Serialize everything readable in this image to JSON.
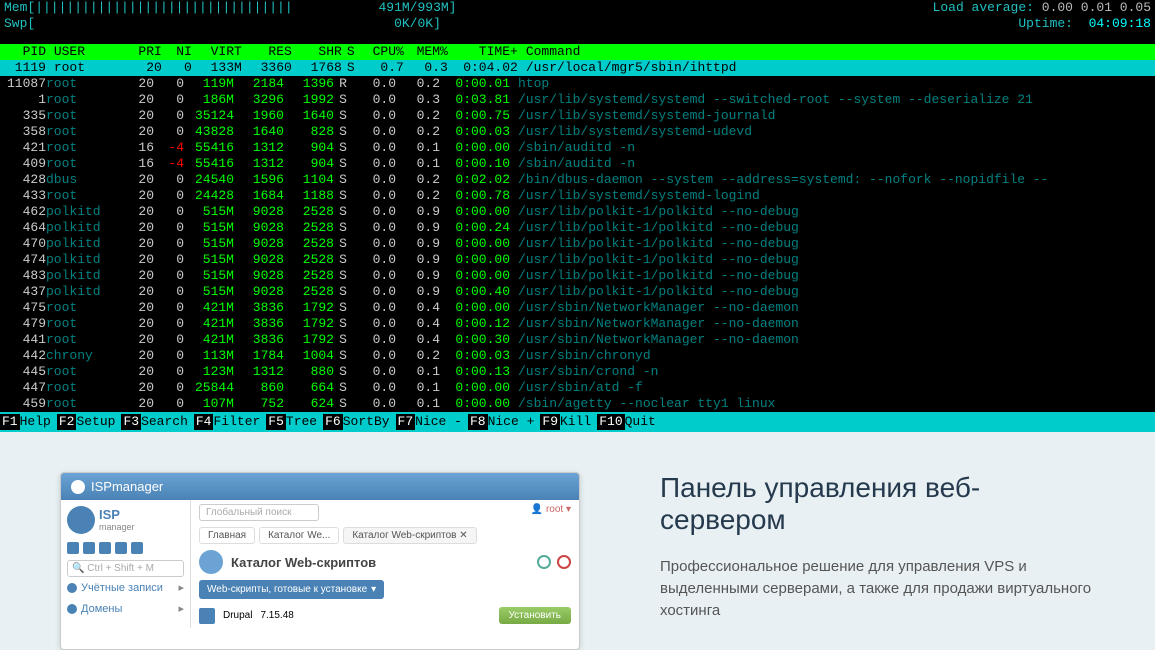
{
  "header": {
    "mem_label": "Mem",
    "mem_bar": "[|||||||||||||||||||||||||||||||||           491M/993M]",
    "swp_label": "Swp",
    "swp_bar": "[                                              0K/0K]",
    "load_label": "Load average:",
    "load_values": "0.00 0.01 0.05",
    "uptime_label": "Uptime:",
    "uptime_value": "04:09:18"
  },
  "columns": {
    "pid": "PID",
    "user": "USER",
    "pri": "PRI",
    "ni": "NI",
    "virt": "VIRT",
    "res": "RES",
    "shr": "SHR",
    "s": "S",
    "cpu": "CPU%",
    "mem": "MEM%",
    "time": "TIME+",
    "cmd": "Command"
  },
  "selected": {
    "pid": "1119",
    "user": "root",
    "pri": "20",
    "ni": "0",
    "virt": "133M",
    "res": "3360",
    "shr": "1768",
    "s": "S",
    "cpu": "0.7",
    "mem": "0.3",
    "time": "0:04.02",
    "cmd": "/usr/local/mgr5/sbin/ihttpd"
  },
  "processes": [
    {
      "pid": "11087",
      "user": "root",
      "pri": "20",
      "ni": "0",
      "virt": "119M",
      "res": "2184",
      "shr": "1396",
      "s": "R",
      "cpu": "0.0",
      "mem": "0.2",
      "time": "0:00.01",
      "cmd": "htop"
    },
    {
      "pid": "1",
      "user": "root",
      "pri": "20",
      "ni": "0",
      "virt": "186M",
      "res": "3296",
      "shr": "1992",
      "s": "S",
      "cpu": "0.0",
      "mem": "0.3",
      "time": "0:03.81",
      "cmd": "/usr/lib/systemd/systemd --switched-root --system --deserialize 21"
    },
    {
      "pid": "335",
      "user": "root",
      "pri": "20",
      "ni": "0",
      "virt": "35124",
      "res": "1960",
      "shr": "1640",
      "s": "S",
      "cpu": "0.0",
      "mem": "0.2",
      "time": "0:00.75",
      "cmd": "/usr/lib/systemd/systemd-journald"
    },
    {
      "pid": "358",
      "user": "root",
      "pri": "20",
      "ni": "0",
      "virt": "43828",
      "res": "1640",
      "shr": "828",
      "s": "S",
      "cpu": "0.0",
      "mem": "0.2",
      "time": "0:00.03",
      "cmd": "/usr/lib/systemd/systemd-udevd"
    },
    {
      "pid": "421",
      "user": "root",
      "pri": "16",
      "ni": "-4",
      "virt": "55416",
      "res": "1312",
      "shr": "904",
      "s": "S",
      "cpu": "0.0",
      "mem": "0.1",
      "time": "0:00.00",
      "cmd": "/sbin/auditd -n"
    },
    {
      "pid": "409",
      "user": "root",
      "pri": "16",
      "ni": "-4",
      "virt": "55416",
      "res": "1312",
      "shr": "904",
      "s": "S",
      "cpu": "0.0",
      "mem": "0.1",
      "time": "0:00.10",
      "cmd": "/sbin/auditd -n"
    },
    {
      "pid": "428",
      "user": "dbus",
      "pri": "20",
      "ni": "0",
      "virt": "24540",
      "res": "1596",
      "shr": "1104",
      "s": "S",
      "cpu": "0.0",
      "mem": "0.2",
      "time": "0:02.02",
      "cmd": "/bin/dbus-daemon --system --address=systemd: --nofork --nopidfile --"
    },
    {
      "pid": "433",
      "user": "root",
      "pri": "20",
      "ni": "0",
      "virt": "24428",
      "res": "1684",
      "shr": "1188",
      "s": "S",
      "cpu": "0.0",
      "mem": "0.2",
      "time": "0:00.78",
      "cmd": "/usr/lib/systemd/systemd-logind"
    },
    {
      "pid": "462",
      "user": "polkitd",
      "pri": "20",
      "ni": "0",
      "virt": "515M",
      "res": "9028",
      "shr": "2528",
      "s": "S",
      "cpu": "0.0",
      "mem": "0.9",
      "time": "0:00.00",
      "cmd": "/usr/lib/polkit-1/polkitd --no-debug"
    },
    {
      "pid": "464",
      "user": "polkitd",
      "pri": "20",
      "ni": "0",
      "virt": "515M",
      "res": "9028",
      "shr": "2528",
      "s": "S",
      "cpu": "0.0",
      "mem": "0.9",
      "time": "0:00.24",
      "cmd": "/usr/lib/polkit-1/polkitd --no-debug"
    },
    {
      "pid": "470",
      "user": "polkitd",
      "pri": "20",
      "ni": "0",
      "virt": "515M",
      "res": "9028",
      "shr": "2528",
      "s": "S",
      "cpu": "0.0",
      "mem": "0.9",
      "time": "0:00.00",
      "cmd": "/usr/lib/polkit-1/polkitd --no-debug"
    },
    {
      "pid": "474",
      "user": "polkitd",
      "pri": "20",
      "ni": "0",
      "virt": "515M",
      "res": "9028",
      "shr": "2528",
      "s": "S",
      "cpu": "0.0",
      "mem": "0.9",
      "time": "0:00.00",
      "cmd": "/usr/lib/polkit-1/polkitd --no-debug"
    },
    {
      "pid": "483",
      "user": "polkitd",
      "pri": "20",
      "ni": "0",
      "virt": "515M",
      "res": "9028",
      "shr": "2528",
      "s": "S",
      "cpu": "0.0",
      "mem": "0.9",
      "time": "0:00.00",
      "cmd": "/usr/lib/polkit-1/polkitd --no-debug"
    },
    {
      "pid": "437",
      "user": "polkitd",
      "pri": "20",
      "ni": "0",
      "virt": "515M",
      "res": "9028",
      "shr": "2528",
      "s": "S",
      "cpu": "0.0",
      "mem": "0.9",
      "time": "0:00.40",
      "cmd": "/usr/lib/polkit-1/polkitd --no-debug"
    },
    {
      "pid": "475",
      "user": "root",
      "pri": "20",
      "ni": "0",
      "virt": "421M",
      "res": "3836",
      "shr": "1792",
      "s": "S",
      "cpu": "0.0",
      "mem": "0.4",
      "time": "0:00.00",
      "cmd": "/usr/sbin/NetworkManager --no-daemon"
    },
    {
      "pid": "479",
      "user": "root",
      "pri": "20",
      "ni": "0",
      "virt": "421M",
      "res": "3836",
      "shr": "1792",
      "s": "S",
      "cpu": "0.0",
      "mem": "0.4",
      "time": "0:00.12",
      "cmd": "/usr/sbin/NetworkManager --no-daemon"
    },
    {
      "pid": "441",
      "user": "root",
      "pri": "20",
      "ni": "0",
      "virt": "421M",
      "res": "3836",
      "shr": "1792",
      "s": "S",
      "cpu": "0.0",
      "mem": "0.4",
      "time": "0:00.30",
      "cmd": "/usr/sbin/NetworkManager --no-daemon"
    },
    {
      "pid": "442",
      "user": "chrony",
      "pri": "20",
      "ni": "0",
      "virt": "113M",
      "res": "1784",
      "shr": "1004",
      "s": "S",
      "cpu": "0.0",
      "mem": "0.2",
      "time": "0:00.03",
      "cmd": "/usr/sbin/chronyd"
    },
    {
      "pid": "445",
      "user": "root",
      "pri": "20",
      "ni": "0",
      "virt": "123M",
      "res": "1312",
      "shr": "880",
      "s": "S",
      "cpu": "0.0",
      "mem": "0.1",
      "time": "0:00.13",
      "cmd": "/usr/sbin/crond -n"
    },
    {
      "pid": "447",
      "user": "root",
      "pri": "20",
      "ni": "0",
      "virt": "25844",
      "res": "860",
      "shr": "664",
      "s": "S",
      "cpu": "0.0",
      "mem": "0.1",
      "time": "0:00.00",
      "cmd": "/usr/sbin/atd -f"
    },
    {
      "pid": "459",
      "user": "root",
      "pri": "20",
      "ni": "0",
      "virt": "107M",
      "res": "752",
      "shr": "624",
      "s": "S",
      "cpu": "0.0",
      "mem": "0.1",
      "time": "0:00.00",
      "cmd": "/sbin/agetty --noclear tty1 linux"
    }
  ],
  "fkeys": [
    {
      "fn": "F1",
      "lbl": "Help"
    },
    {
      "fn": "F2",
      "lbl": "Setup"
    },
    {
      "fn": "F3",
      "lbl": "Search"
    },
    {
      "fn": "F4",
      "lbl": "Filter"
    },
    {
      "fn": "F5",
      "lbl": "Tree"
    },
    {
      "fn": "F6",
      "lbl": "SortBy"
    },
    {
      "fn": "F7",
      "lbl": "Nice -"
    },
    {
      "fn": "F8",
      "lbl": "Nice +"
    },
    {
      "fn": "F9",
      "lbl": "Kill"
    },
    {
      "fn": "F10",
      "lbl": "Quit"
    }
  ],
  "panel": {
    "window_title": "ISPmanager",
    "logo_text": "ISP",
    "logo_sub": "manager",
    "search_placeholder": "Ctrl + Shift + M",
    "global_search": "Глобальный поиск",
    "user_label": "root",
    "menu": [
      {
        "label": "Учётные записи"
      },
      {
        "label": "Домены"
      }
    ],
    "breadcrumbs": [
      "Главная",
      "Каталог We...",
      "Каталог Web-скриптов"
    ],
    "catalog_title": "Каталог Web-скриптов",
    "dropdown": "Web-скрипты, готовые к установке",
    "app_name": "Drupal",
    "app_ver": "7.15.48",
    "install_btn": "Установить"
  },
  "marketing": {
    "title": "Панель управления веб-сервером",
    "desc": "Профессиональное решение для управления VPS и выделенными серверами, а также для продажи виртуального хостинга"
  }
}
